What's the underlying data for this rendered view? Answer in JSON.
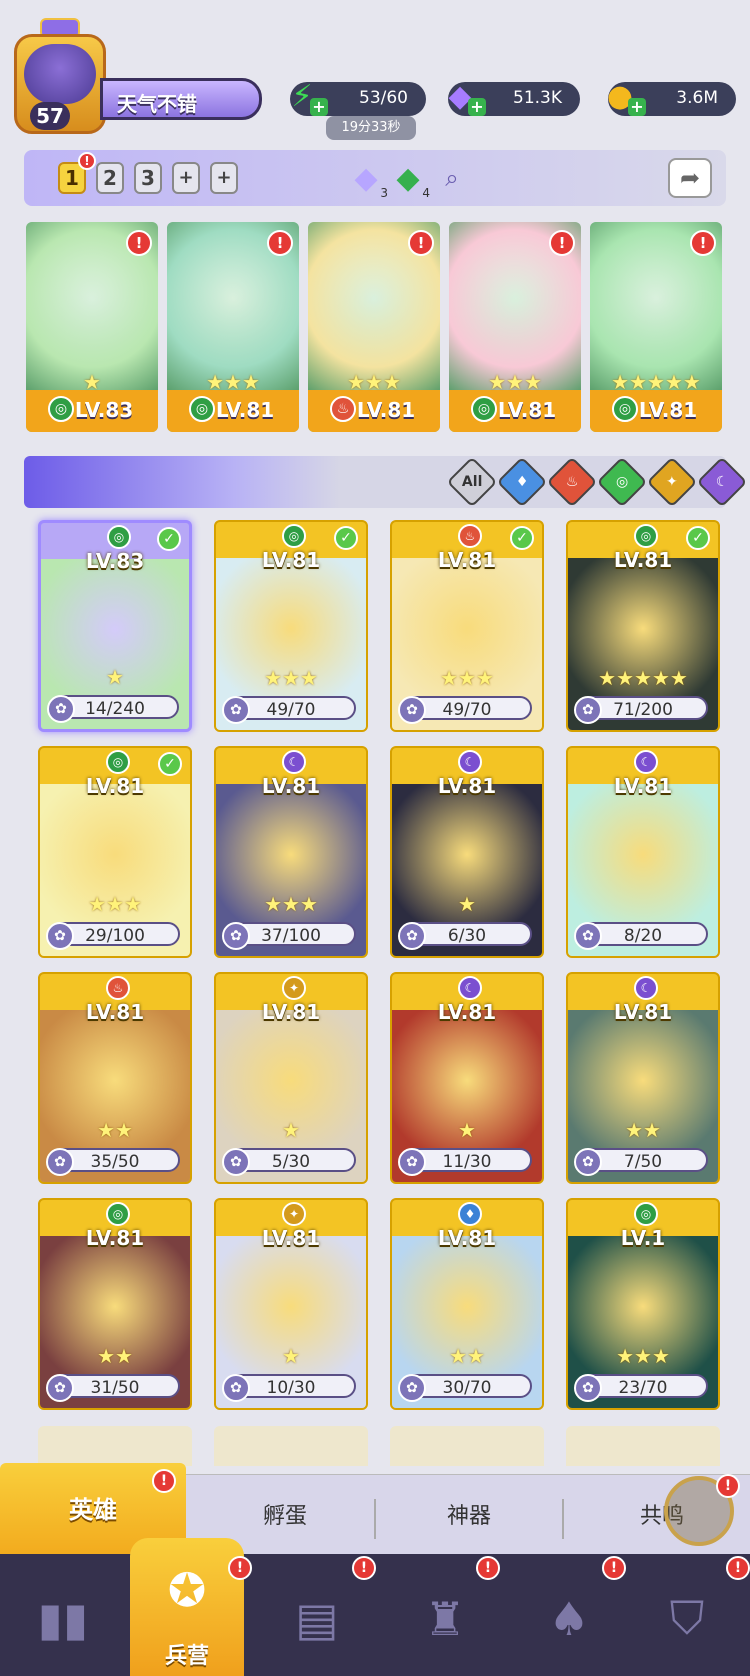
{
  "player": {
    "level": "57",
    "name": "天气不错"
  },
  "resources": {
    "energy": {
      "value": "53/60",
      "icon": "lightning-icon",
      "timer": "19分33秒"
    },
    "gems": {
      "value": "51.3K",
      "icon": "diamond-icon"
    },
    "gold": {
      "value": "3.6M",
      "icon": "coin-icon"
    }
  },
  "team": {
    "tabs": [
      {
        "label": "1"
      },
      {
        "label": "2"
      },
      {
        "label": "3"
      },
      {
        "label": "+"
      },
      {
        "label": "+"
      }
    ],
    "gem_a": "3",
    "gem_b": "4"
  },
  "lineup": [
    {
      "level": "LV.83",
      "element": "wind",
      "stars": "★"
    },
    {
      "level": "LV.81",
      "element": "wind",
      "stars": "★★★"
    },
    {
      "level": "LV.81",
      "element": "fire",
      "stars": "★★★"
    },
    {
      "level": "LV.81",
      "element": "wind",
      "stars": "★★★"
    },
    {
      "level": "LV.81",
      "element": "wind",
      "stars": "★★★★★"
    }
  ],
  "filters": {
    "all_label": "All",
    "colors": [
      "#4a90e2",
      "#e0533a",
      "#3fb950",
      "#e0a521",
      "#8a5bd6"
    ]
  },
  "heroes": [
    {
      "level": "LV.83",
      "element": "wind",
      "stars": "★",
      "shards": "14/240",
      "owned_check": true
    },
    {
      "level": "LV.81",
      "element": "wind",
      "stars": "★★★",
      "shards": "49/70",
      "owned_check": true
    },
    {
      "level": "LV.81",
      "element": "fire",
      "stars": "★★★",
      "shards": "49/70",
      "owned_check": true
    },
    {
      "level": "LV.81",
      "element": "wind",
      "stars": "★★★★★",
      "shards": "71/200",
      "owned_check": true
    },
    {
      "level": "LV.81",
      "element": "wind",
      "stars": "★★★",
      "shards": "29/100",
      "owned_check": true
    },
    {
      "level": "LV.81",
      "element": "dark",
      "stars": "★★★",
      "shards": "37/100",
      "owned_check": false
    },
    {
      "level": "LV.81",
      "element": "dark",
      "stars": "★",
      "shards": "6/30",
      "owned_check": false
    },
    {
      "level": "LV.81",
      "element": "dark",
      "stars": "",
      "shards": "8/20",
      "owned_check": false
    },
    {
      "level": "LV.81",
      "element": "fire",
      "stars": "★★",
      "shards": "35/50",
      "owned_check": false
    },
    {
      "level": "LV.81",
      "element": "light",
      "stars": "★",
      "shards": "5/30",
      "owned_check": false
    },
    {
      "level": "LV.81",
      "element": "dark",
      "stars": "★",
      "shards": "11/30",
      "owned_check": false
    },
    {
      "level": "LV.81",
      "element": "dark",
      "stars": "★★",
      "shards": "7/50",
      "owned_check": false
    },
    {
      "level": "LV.81",
      "element": "wind",
      "stars": "★★",
      "shards": "31/50",
      "owned_check": false
    },
    {
      "level": "LV.81",
      "element": "light",
      "stars": "★",
      "shards": "10/30",
      "owned_check": false
    },
    {
      "level": "LV.81",
      "element": "water",
      "stars": "★★",
      "shards": "30/70",
      "owned_check": false
    },
    {
      "level": "LV.1",
      "element": "wind",
      "stars": "★★★",
      "shards": "23/70",
      "owned_check": false
    }
  ],
  "element_colors": {
    "wind": "#2f9e44",
    "fire": "#e0533a",
    "water": "#3b82d6",
    "light": "#d49a1c",
    "dark": "#7b4fd0"
  },
  "sub_tabs": {
    "heroes": "英雄",
    "hatch": "孵蛋",
    "artifacts": "神器",
    "resonance": "共鸣"
  },
  "nav": {
    "barracks": "兵营"
  }
}
